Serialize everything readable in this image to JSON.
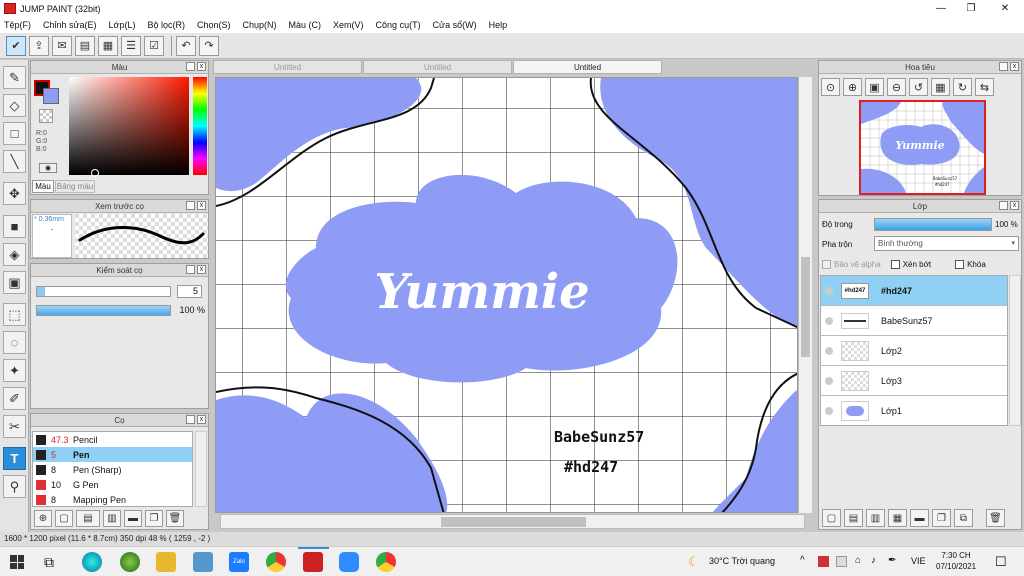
{
  "window": {
    "title": "JUMP PAINT (32bit)",
    "min": "—",
    "max": "❐",
    "close": "✕"
  },
  "menu": [
    "Tệp(F)",
    "Chỉnh sửa(E)",
    "Lớp(L)",
    "Bộ lọc(R)",
    "Chọn(S)",
    "Chụp(N)",
    "Màu (C)",
    "Xem(V)",
    "Công cụ(T)",
    "Cửa sổ(W)",
    "Help"
  ],
  "color_panel": {
    "title": "Màu",
    "r": "R:0",
    "g": "G:0",
    "b": "B:0",
    "tab_color": "Màu",
    "tab_palette": "Bảng màu"
  },
  "brush_preview": {
    "title": "Xem trước cọ",
    "size": "* 0.36mm",
    "dot": "·"
  },
  "brush_control": {
    "title": "Kiểm soát cọ",
    "size_value": "5",
    "opacity_value": "100 %",
    "opacity": 1.0
  },
  "brush_panel": {
    "title": "Cọ",
    "items": [
      {
        "size": "47.3",
        "name": "Pencil",
        "swatch": "#222222"
      },
      {
        "size": "5",
        "name": "Pen",
        "swatch": "#222222"
      },
      {
        "size": "8",
        "name": "Pen (Sharp)",
        "swatch": "#222222"
      },
      {
        "size": "10",
        "name": "G Pen",
        "swatch": "#e03030"
      },
      {
        "size": "8",
        "name": "Mapping Pen",
        "swatch": "#e03030"
      }
    ]
  },
  "tabs": [
    "Untitled",
    "Untitled",
    "Untitled"
  ],
  "canvas": {
    "main_text": "Yummie",
    "line1": "BabeSunz57",
    "line2": "#hd247",
    "blob_color": "#8f9cf5"
  },
  "navigator": {
    "title": "Hoa tiêu",
    "thumb_text": "Yummie",
    "thumb_small1": "BabeSunz57",
    "thumb_small2": "#hd247"
  },
  "layers": {
    "title": "Lớp",
    "opacity_label": "Độ trong",
    "opacity_value": "100 %",
    "opacity": 1.0,
    "blend_label": "Pha trộn",
    "blend_value": "Bình thường",
    "alpha_label": "Bảo vệ alpha",
    "clip_label": "Xén bớt",
    "lock_label": "Khóa",
    "items": [
      {
        "name": "#hd247",
        "thumb": "#hd247"
      },
      {
        "name": "BabeSunz57",
        "thumb": ""
      },
      {
        "name": "Lớp2",
        "thumb": ""
      },
      {
        "name": "Lớp3",
        "thumb": ""
      },
      {
        "name": "Lớp1",
        "thumb": ""
      }
    ]
  },
  "status": "1600 * 1200 pixel  (11.6 * 8.7cm)  350 dpi  48 %  ( 1259 , -2 )",
  "taskbar": {
    "weather": "30°C  Trời quang",
    "lang": "VIE",
    "time": "7:30 CH",
    "date": "07/10/2021",
    "zalo": "Zalo"
  }
}
